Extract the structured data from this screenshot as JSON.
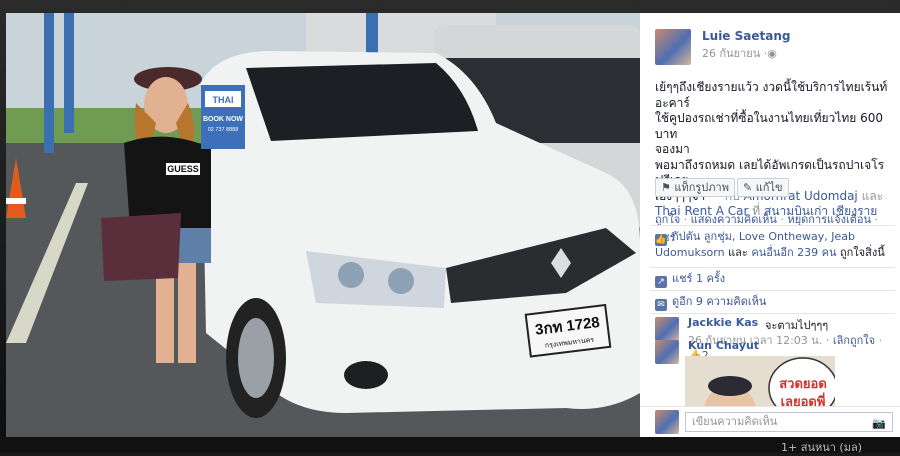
{
  "photo": {
    "plate_number": "3กท 1728",
    "plate_province": "กรุงเทพมหานคร",
    "sign_brand": "THAI",
    "sign_cta": "BOOK NOW",
    "sign_phone": "02 737 8888",
    "shirt_text": "GUESS"
  },
  "post": {
    "author": "Luie Saetang",
    "date": "26 กันยายน",
    "caption_line1": "เย้ๆๆถึงเชียงรายแว้ว งวดนี้ใช้บริการไทยเร้นท์อะคาร์",
    "caption_line2": "ใช้คูปองรถเช่าที่ซื้อในงานไทยเที่ยวไทย 600 บาท",
    "caption_line3": "จองมา",
    "caption_line4": "พอมาถึงรถหมด เลยได้อัพเกรดเป็นรถปาเจโรฟรีเลย",
    "caption_line5": "เองๆๆๆจ้า",
    "caption_with": "— กับ",
    "tag1": "Amornrat Udomdaj",
    "and": "และ",
    "tag2": "Thai Rent A Car",
    "at": "ที่",
    "place": "สนามบินเก่า เชียงราย",
    "tag_photo_label": "แท็กรูปภาพ",
    "edit_label": "แก้ไข",
    "action_like": "ถูกใจ",
    "action_comment": "แสดงความคิดเห็น",
    "action_stop": "หยุดการแจ้งเตือน",
    "action_share": "แชร์",
    "likes_text": "กัปตัน ลูกชุ่ม, Love Ontheway, Jeab",
    "likes_text2": "Udomuksorn",
    "likes_others": "คนอื่นอีก 239 คน",
    "likes_suffix": "ถูกใจสิ่งนี้",
    "shares": "แชร์ 1 ครั้ง",
    "view_comments": "ดูอีก 9 ความคิดเห็น"
  },
  "comments": [
    {
      "name": "Jackkie Kas",
      "text": "จะตามไปๆๆๆ",
      "meta": "26 กันยายน เวลา 12:03 น.",
      "unlike": "เลิกถูกใจ",
      "likes": "2"
    },
    {
      "name": "Kun Chayut",
      "image_text1": "สวดยอด",
      "image_text2": "เลยอดพี่"
    }
  ],
  "composer": {
    "placeholder": "เขียนความคิดเห็น"
  },
  "bottom": {
    "text": "1+ สนหนา (มล)"
  },
  "icons": [
    "globe-icon",
    "tag-icon",
    "edit-icon",
    "like-icon",
    "share-icon",
    "comment-icon",
    "camera-icon"
  ]
}
